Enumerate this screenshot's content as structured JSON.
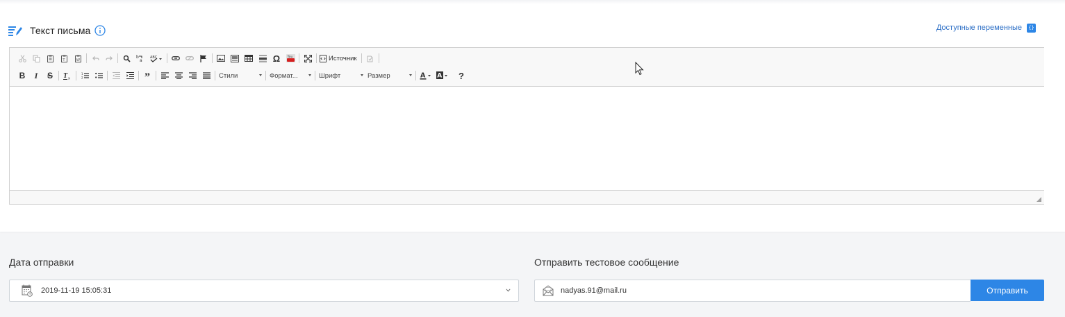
{
  "email_body_section": {
    "title": "Текст письма",
    "variables_link": "Доступные переменные",
    "variables_badge": "{}"
  },
  "editor": {
    "source_label": "Источник",
    "combos": {
      "styles": "Стили",
      "format": "Формат...",
      "font": "Шрифт",
      "size": "Размер"
    },
    "help_label": "?",
    "omega_label": "Ω"
  },
  "send_date": {
    "label": "Дата отправки",
    "value": "2019-11-19 15:05:31"
  },
  "test_message": {
    "label": "Отправить тестовое сообщение",
    "email_value": "nadyas.91@mail.ru",
    "send_button": "Отправить"
  },
  "colors": {
    "accent": "#2d86e6",
    "link": "#2d6fc6"
  }
}
